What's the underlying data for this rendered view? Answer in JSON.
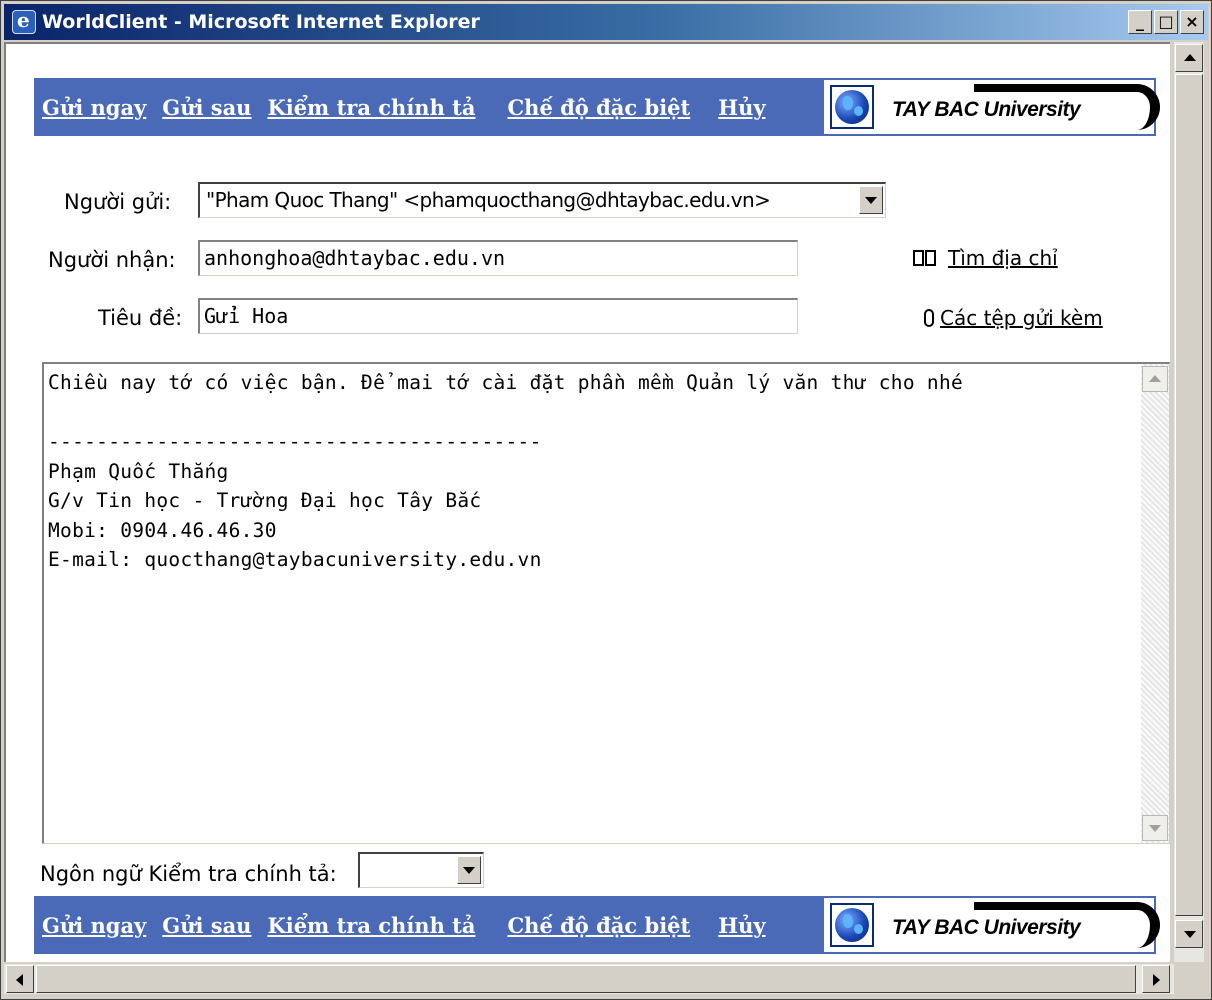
{
  "window": {
    "title": "WorldClient - Microsoft Internet Explorer",
    "minimize": "_",
    "maximize": "□",
    "close": "×"
  },
  "toolbar": {
    "send_now": "Gửi ngay",
    "send_later": "Gửi sau",
    "spell_check": "Kiểm tra chính tả",
    "special_mode": "Chế độ đặc biệt",
    "cancel": "Hủy",
    "logo_text": "TAY BAC University"
  },
  "form": {
    "from_label": "Người gửi:",
    "from_value": "\"Pham Quoc Thang\" <phamquocthang@dhtaybac.edu.vn>",
    "to_label": "Người nhận:",
    "to_value": "anhonghoa@dhtaybac.edu.vn",
    "find_address": "Tìm địa chỉ",
    "subject_label": "Tiêu đề:",
    "subject_value": "Gửi Hoa",
    "attachments": "Các tệp gửi kèm"
  },
  "message": {
    "body": "Chiều nay tớ có việc bận. Để mai tớ cài đặt phần mềm Quản lý văn thư cho nhé\n\n-----------------------------------------\nPhạm Quốc Thắng\nG/v Tin học - Trường Đại học Tây Bắc\nMobi: 0904.46.46.30\nE-mail: quocthang@taybacuniversity.edu.vn"
  },
  "spellcheck": {
    "language_label": "Ngôn ngữ Kiểm tra chính tả:",
    "language_value": ""
  },
  "colors": {
    "toolbar_bg": "#4a6ab8",
    "title_bar": "#0a246a"
  },
  "icons": [
    "ie-icon",
    "book-icon",
    "paperclip-icon",
    "globe-icon"
  ]
}
